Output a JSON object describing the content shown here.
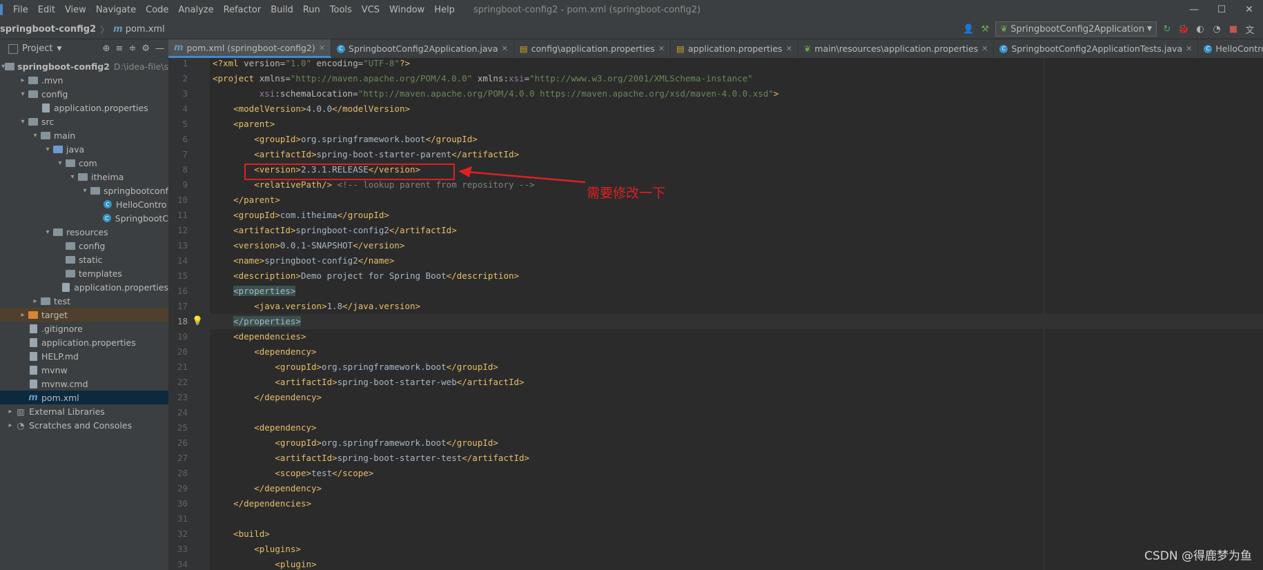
{
  "menubar": {
    "items": [
      "File",
      "Edit",
      "View",
      "Navigate",
      "Code",
      "Analyze",
      "Refactor",
      "Build",
      "Run",
      "Tools",
      "VCS",
      "Window",
      "Help"
    ],
    "title": "springboot-config2 - pom.xml (springboot-config2)"
  },
  "navbar": {
    "project": "springboot-config2",
    "file": "pom.xml",
    "run_config": "SpringbootConfig2Application"
  },
  "project_panel": {
    "label": "Project"
  },
  "tree": [
    {
      "depth": 0,
      "arrow": "open",
      "icon": "module",
      "label": "springboot-config2",
      "extra": "D:\\idea-file\\s",
      "bold": true
    },
    {
      "depth": 1,
      "arrow": "closed",
      "icon": "folder",
      "label": ".mvn"
    },
    {
      "depth": 1,
      "arrow": "open",
      "icon": "folder",
      "label": "config"
    },
    {
      "depth": 2,
      "arrow": "",
      "icon": "file",
      "label": "application.properties"
    },
    {
      "depth": 1,
      "arrow": "open",
      "icon": "folder",
      "label": "src"
    },
    {
      "depth": 2,
      "arrow": "open",
      "icon": "folder",
      "label": "main"
    },
    {
      "depth": 3,
      "arrow": "open",
      "icon": "folder-blue",
      "label": "java"
    },
    {
      "depth": 4,
      "arrow": "open",
      "icon": "folder",
      "label": "com"
    },
    {
      "depth": 5,
      "arrow": "open",
      "icon": "folder",
      "label": "itheima"
    },
    {
      "depth": 6,
      "arrow": "open",
      "icon": "folder",
      "label": "springbootconf"
    },
    {
      "depth": 7,
      "arrow": "",
      "icon": "class",
      "label": "HelloContro"
    },
    {
      "depth": 7,
      "arrow": "",
      "icon": "class",
      "label": "SpringbootC"
    },
    {
      "depth": 3,
      "arrow": "open",
      "icon": "folder",
      "label": "resources"
    },
    {
      "depth": 4,
      "arrow": "",
      "icon": "folder",
      "label": "config"
    },
    {
      "depth": 4,
      "arrow": "",
      "icon": "folder",
      "label": "static"
    },
    {
      "depth": 4,
      "arrow": "",
      "icon": "folder",
      "label": "templates"
    },
    {
      "depth": 4,
      "arrow": "",
      "icon": "file",
      "label": "application.properties"
    },
    {
      "depth": 2,
      "arrow": "closed",
      "icon": "folder",
      "label": "test"
    },
    {
      "depth": 1,
      "arrow": "closed",
      "icon": "folder-orange",
      "label": "target",
      "state": "excluded"
    },
    {
      "depth": 1,
      "arrow": "",
      "icon": "file",
      "label": ".gitignore"
    },
    {
      "depth": 1,
      "arrow": "",
      "icon": "file",
      "label": "application.properties"
    },
    {
      "depth": 1,
      "arrow": "",
      "icon": "file",
      "label": "HELP.md"
    },
    {
      "depth": 1,
      "arrow": "",
      "icon": "file",
      "label": "mvnw"
    },
    {
      "depth": 1,
      "arrow": "",
      "icon": "file",
      "label": "mvnw.cmd"
    },
    {
      "depth": 1,
      "arrow": "",
      "icon": "maven",
      "label": "pom.xml",
      "state": "selected"
    },
    {
      "depth": 0,
      "arrow": "closed",
      "icon": "library",
      "label": "External Libraries"
    },
    {
      "depth": 0,
      "arrow": "closed",
      "icon": "scratch",
      "label": "Scratches and Consoles"
    }
  ],
  "tabs": [
    {
      "label": "pom.xml (springboot-config2)",
      "icon": "maven",
      "active": true
    },
    {
      "label": "SpringbootConfig2Application.java",
      "icon": "class"
    },
    {
      "label": "config\\application.properties",
      "icon": "properties"
    },
    {
      "label": "application.properties",
      "icon": "properties"
    },
    {
      "label": "main\\resources\\application.properties",
      "icon": "spring"
    },
    {
      "label": "SpringbootConfig2ApplicationTests.java",
      "icon": "class"
    },
    {
      "label": "HelloController.java",
      "icon": "class"
    }
  ],
  "code_lines": [
    [
      [
        "tag",
        "<?xml "
      ],
      [
        "attr",
        "version="
      ],
      [
        "str",
        "\"1.0\" "
      ],
      [
        "attr",
        "encoding="
      ],
      [
        "str",
        "\"UTF-8\""
      ],
      [
        "tag",
        "?>"
      ]
    ],
    [
      [
        "tag",
        "<project "
      ],
      [
        "attr",
        "xmlns="
      ],
      [
        "str",
        "\"http://maven.apache.org/POM/4.0.0\" "
      ],
      [
        "attr",
        "xmlns:"
      ],
      [
        "ns",
        "xsi"
      ],
      [
        "attr",
        "="
      ],
      [
        "str",
        "\"http://www.w3.org/2001/XMLSchema-instance\""
      ]
    ],
    [
      [
        "txt",
        "         "
      ],
      [
        "ns",
        "xsi"
      ],
      [
        "attr",
        ":schemaLocation="
      ],
      [
        "str",
        "\"http://maven.apache.org/POM/4.0.0 https://maven.apache.org/xsd/maven-4.0.0.xsd\""
      ],
      [
        "tag",
        ">"
      ]
    ],
    [
      [
        "txt",
        "    "
      ],
      [
        "tag",
        "<modelVersion>"
      ],
      [
        "txt",
        "4.0.0"
      ],
      [
        "tag",
        "</modelVersion>"
      ]
    ],
    [
      [
        "txt",
        "    "
      ],
      [
        "tag",
        "<parent>"
      ]
    ],
    [
      [
        "txt",
        "        "
      ],
      [
        "tag",
        "<groupId>"
      ],
      [
        "txt",
        "org.springframework.boot"
      ],
      [
        "tag",
        "</groupId>"
      ]
    ],
    [
      [
        "txt",
        "        "
      ],
      [
        "tag",
        "<artifactId>"
      ],
      [
        "txt",
        "spring-boot-starter-parent"
      ],
      [
        "tag",
        "</artifactId>"
      ]
    ],
    [
      [
        "txt",
        "        "
      ],
      [
        "tag",
        "<version>"
      ],
      [
        "txt",
        "2.3.1.RELEASE"
      ],
      [
        "tag",
        "</version>"
      ]
    ],
    [
      [
        "txt",
        "        "
      ],
      [
        "tag",
        "<relativePath/>"
      ],
      [
        "txt",
        " "
      ],
      [
        "com",
        "<!-- lookup parent from repository -->"
      ]
    ],
    [
      [
        "txt",
        "    "
      ],
      [
        "tag",
        "</parent>"
      ]
    ],
    [
      [
        "txt",
        "    "
      ],
      [
        "tag",
        "<groupId>"
      ],
      [
        "txt",
        "com.itheima"
      ],
      [
        "tag",
        "</groupId>"
      ]
    ],
    [
      [
        "txt",
        "    "
      ],
      [
        "tag",
        "<artifactId>"
      ],
      [
        "txt",
        "springboot-config2"
      ],
      [
        "tag",
        "</artifactId>"
      ]
    ],
    [
      [
        "txt",
        "    "
      ],
      [
        "tag",
        "<version>"
      ],
      [
        "txt",
        "0.0.1-SNAPSHOT"
      ],
      [
        "tag",
        "</version>"
      ]
    ],
    [
      [
        "txt",
        "    "
      ],
      [
        "tag",
        "<name>"
      ],
      [
        "txt",
        "springboot-config2"
      ],
      [
        "tag",
        "</name>"
      ]
    ],
    [
      [
        "txt",
        "    "
      ],
      [
        "tag",
        "<description>"
      ],
      [
        "txt",
        "Demo project for Spring Boot"
      ],
      [
        "tag",
        "</description>"
      ]
    ],
    [
      [
        "txt",
        "    "
      ],
      [
        "hl",
        "<properties>"
      ]
    ],
    [
      [
        "txt",
        "        "
      ],
      [
        "tag",
        "<java.version>"
      ],
      [
        "txt",
        "1.8"
      ],
      [
        "tag",
        "</java.version>"
      ]
    ],
    [
      [
        "txt",
        "    "
      ],
      [
        "hl",
        "</properties>"
      ]
    ],
    [
      [
        "txt",
        "    "
      ],
      [
        "tag",
        "<dependencies>"
      ]
    ],
    [
      [
        "txt",
        "        "
      ],
      [
        "tag",
        "<dependency>"
      ]
    ],
    [
      [
        "txt",
        "            "
      ],
      [
        "tag",
        "<groupId>"
      ],
      [
        "txt",
        "org.springframework.boot"
      ],
      [
        "tag",
        "</groupId>"
      ]
    ],
    [
      [
        "txt",
        "            "
      ],
      [
        "tag",
        "<artifactId>"
      ],
      [
        "txt",
        "spring-boot-starter-web"
      ],
      [
        "tag",
        "</artifactId>"
      ]
    ],
    [
      [
        "txt",
        "        "
      ],
      [
        "tag",
        "</dependency>"
      ]
    ],
    [
      [
        "txt",
        ""
      ]
    ],
    [
      [
        "txt",
        "        "
      ],
      [
        "tag",
        "<dependency>"
      ]
    ],
    [
      [
        "txt",
        "            "
      ],
      [
        "tag",
        "<groupId>"
      ],
      [
        "txt",
        "org.springframework.boot"
      ],
      [
        "tag",
        "</groupId>"
      ]
    ],
    [
      [
        "txt",
        "            "
      ],
      [
        "tag",
        "<artifactId>"
      ],
      [
        "txt",
        "spring-boot-starter-test"
      ],
      [
        "tag",
        "</artifactId>"
      ]
    ],
    [
      [
        "txt",
        "            "
      ],
      [
        "tag",
        "<scope>"
      ],
      [
        "txt",
        "test"
      ],
      [
        "tag",
        "</scope>"
      ]
    ],
    [
      [
        "txt",
        "        "
      ],
      [
        "tag",
        "</dependency>"
      ]
    ],
    [
      [
        "txt",
        "    "
      ],
      [
        "tag",
        "</dependencies>"
      ]
    ],
    [
      [
        "txt",
        ""
      ]
    ],
    [
      [
        "txt",
        "    "
      ],
      [
        "tag",
        "<build>"
      ]
    ],
    [
      [
        "txt",
        "        "
      ],
      [
        "tag",
        "<plugins>"
      ]
    ],
    [
      [
        "txt",
        "            "
      ],
      [
        "tag",
        "<plugin>"
      ]
    ]
  ],
  "current_line": 18,
  "annotation": {
    "text": "需要修改一下",
    "color": "#e02020"
  },
  "watermark": "CSDN @得鹿梦为鱼"
}
